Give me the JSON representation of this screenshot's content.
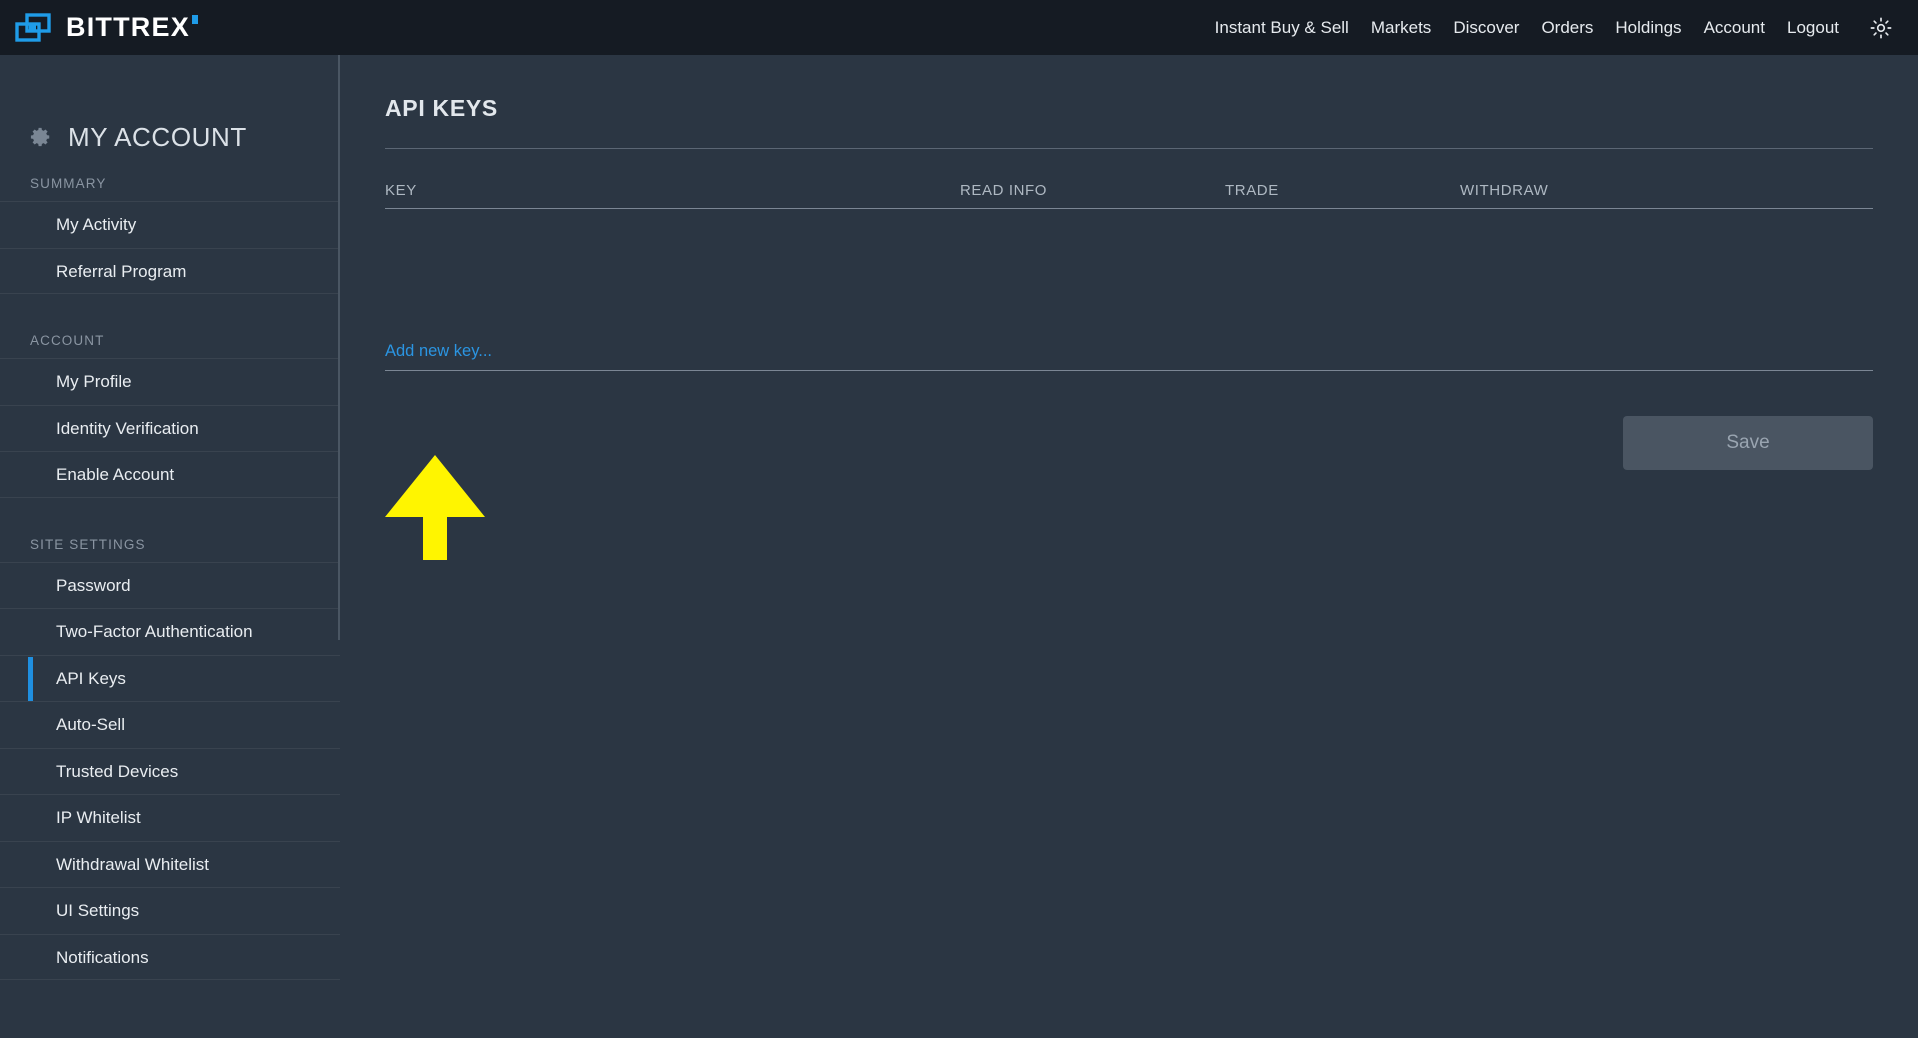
{
  "header": {
    "brand_name": "BITTREX",
    "logo_icon": "bittrex-logo-icon",
    "nav_items": [
      {
        "label": "Instant Buy & Sell"
      },
      {
        "label": "Markets"
      },
      {
        "label": "Discover"
      },
      {
        "label": "Orders"
      },
      {
        "label": "Holdings"
      },
      {
        "label": "Account"
      },
      {
        "label": "Logout"
      }
    ],
    "theme_toggle_icon": "sun-icon"
  },
  "sidebar": {
    "title": "MY ACCOUNT",
    "title_icon": "gear-icon",
    "groups": [
      {
        "label": "SUMMARY",
        "items": [
          {
            "label": "My Activity",
            "active": false
          },
          {
            "label": "Referral Program",
            "active": false
          }
        ]
      },
      {
        "label": "ACCOUNT",
        "items": [
          {
            "label": "My Profile",
            "active": false
          },
          {
            "label": "Identity Verification",
            "active": false
          },
          {
            "label": "Enable Account",
            "active": false
          }
        ]
      },
      {
        "label": "SITE SETTINGS",
        "items": [
          {
            "label": "Password",
            "active": false
          },
          {
            "label": "Two-Factor Authentication",
            "active": false
          },
          {
            "label": "API Keys",
            "active": true
          },
          {
            "label": "Auto-Sell",
            "active": false
          },
          {
            "label": "Trusted Devices",
            "active": false
          },
          {
            "label": "IP Whitelist",
            "active": false
          },
          {
            "label": "Withdrawal Whitelist",
            "active": false
          },
          {
            "label": "UI Settings",
            "active": false
          },
          {
            "label": "Notifications",
            "active": false
          }
        ]
      }
    ]
  },
  "main": {
    "page_title": "API KEYS",
    "table": {
      "columns": [
        "KEY",
        "READ INFO",
        "TRADE",
        "WITHDRAW"
      ],
      "rows": []
    },
    "add_new_key_label": "Add new key...",
    "save_label": "Save",
    "save_disabled": true
  },
  "annotation": {
    "arrow_color": "#FFF500",
    "arrow_direction": "up",
    "points_at": "Add new key..."
  },
  "colors": {
    "header_bg": "#151b23",
    "body_bg": "#2b3643",
    "accent_blue": "#1f8fe0",
    "link_blue": "#2b95e2",
    "logo_blue": "#1f9ce8",
    "annotation_yellow": "#FFF500",
    "divider": "#5b6674",
    "muted_text": "#8a95a2"
  }
}
